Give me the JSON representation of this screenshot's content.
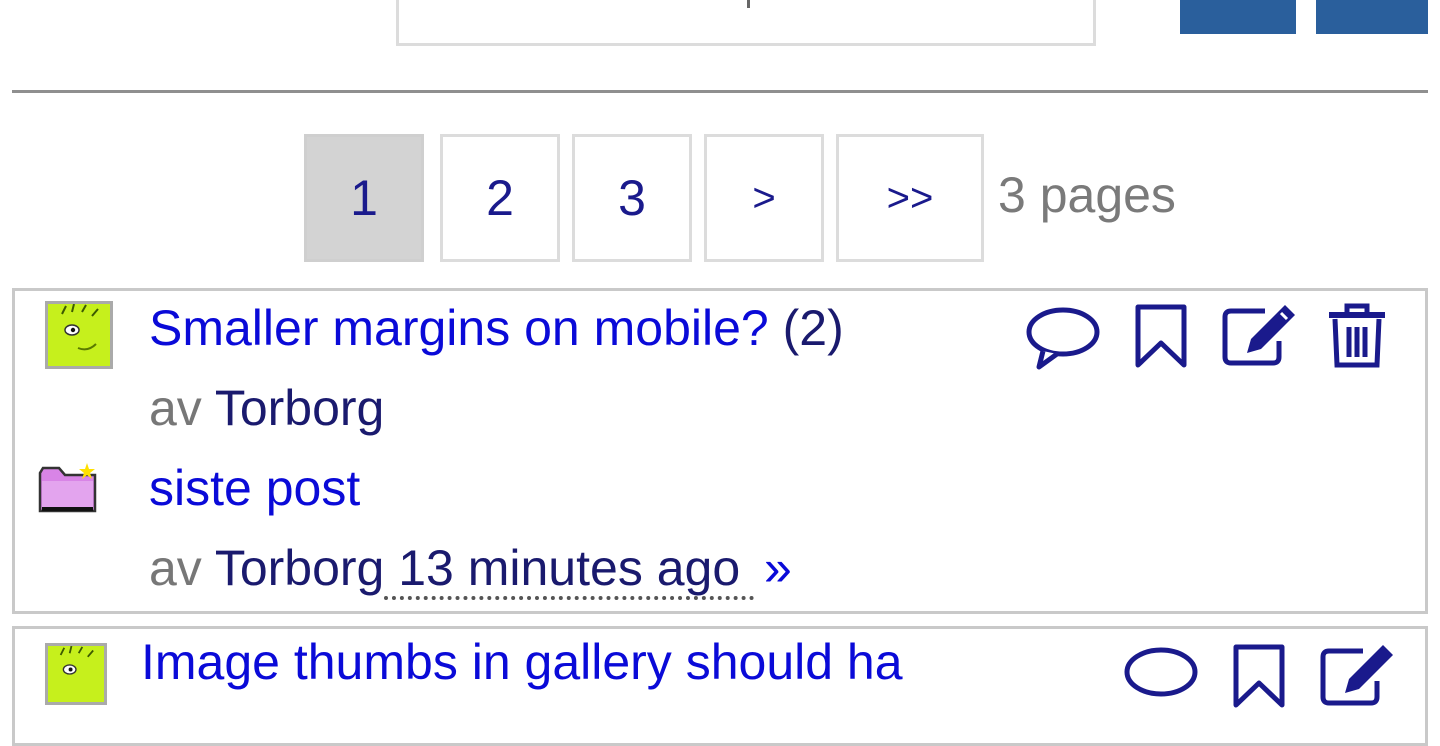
{
  "pagination": {
    "pages": [
      "1",
      "2",
      "3"
    ],
    "current": "1",
    "next_label": ">",
    "last_label": ">>",
    "info": "3 pages"
  },
  "topics": [
    {
      "title": "Smaller margins on mobile?",
      "replies": "(2)",
      "by_label": "av",
      "author": "Torborg",
      "last_post_label": "siste post",
      "last_post_by_label": "av",
      "last_post_author": "Torborg",
      "last_post_time": " 13 minutes ago ",
      "goto_label": "»"
    },
    {
      "title": "Image thumbs in gallery should ha"
    }
  ],
  "icons": {
    "reply": "speech-bubble-icon",
    "bookmark": "bookmark-icon",
    "edit": "edit-icon",
    "delete": "trash-icon",
    "new_posts": "folder-new-icon"
  },
  "colors": {
    "link": "#0a0ad8",
    "author": "#1a1a6e",
    "muted": "#777777",
    "current_page_bg": "#d3d3d3",
    "top_button": "#2a5f9c"
  }
}
